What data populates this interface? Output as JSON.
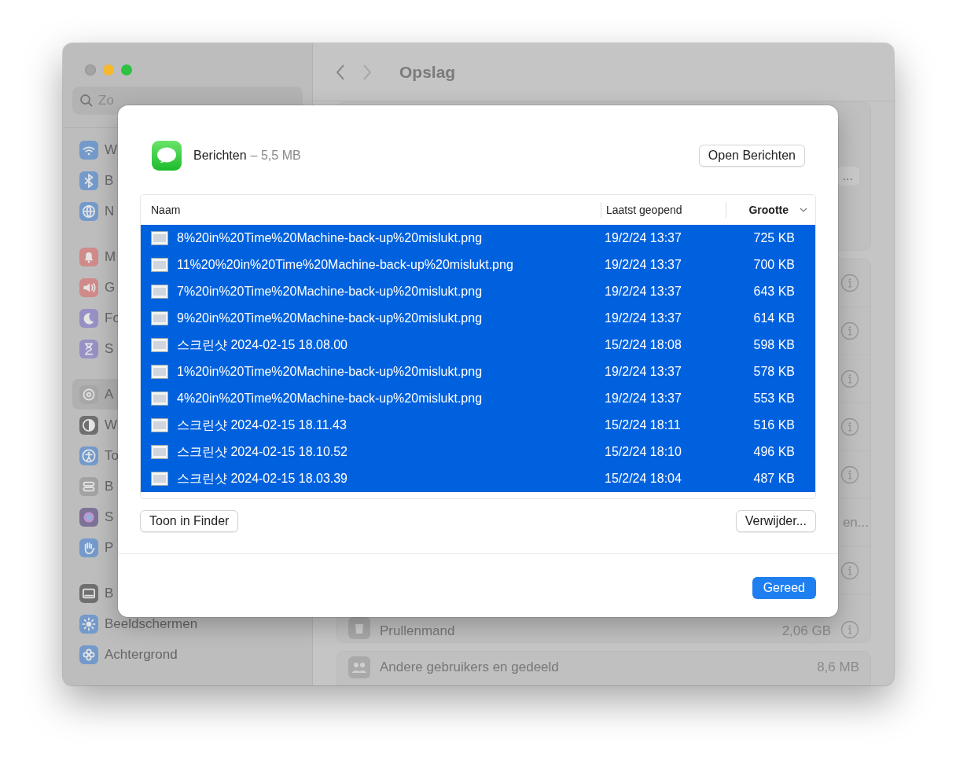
{
  "sidebar": {
    "search": {
      "placeholder": "Zo"
    },
    "groups": [
      {
        "items": [
          {
            "label": "W",
            "selected": false
          },
          {
            "label": "B",
            "selected": false
          },
          {
            "label": "N",
            "selected": false
          }
        ]
      },
      {
        "items": [
          {
            "label": "M",
            "selected": false
          },
          {
            "label": "G",
            "selected": false
          },
          {
            "label": "Fo",
            "selected": false
          },
          {
            "label": "S",
            "selected": false
          }
        ]
      },
      {
        "items": [
          {
            "label": "A",
            "selected": true
          },
          {
            "label": "W",
            "selected": false
          },
          {
            "label": "To",
            "selected": false
          },
          {
            "label": "B",
            "selected": false
          },
          {
            "label": "S",
            "selected": false
          },
          {
            "label": "P",
            "selected": false
          }
        ]
      },
      {
        "items": [
          {
            "label": "B",
            "selected": false
          },
          {
            "label": "Beeldschermen",
            "selected": false
          },
          {
            "label": "Achtergrond",
            "selected": false
          }
        ]
      }
    ]
  },
  "toolbar": {
    "title": "Opslag"
  },
  "content": {
    "top_card": {
      "button": "..."
    },
    "rows": [
      {
        "kind": "info"
      },
      {
        "kind": "info"
      },
      {
        "kind": "info"
      },
      {
        "kind": "info"
      },
      {
        "kind": "info"
      },
      {
        "kind": "text",
        "value": "en..."
      },
      {
        "kind": "info"
      },
      {
        "kind": "item",
        "label": "Prullenmand",
        "value": "2,06 GB"
      }
    ],
    "bottom_card": {
      "label": "Andere gebruikers en gedeeld",
      "value": "8,6 MB"
    }
  },
  "sheet": {
    "app_name": "Berichten",
    "app_size": "– 5,5 MB",
    "open_button": "Open Berichten",
    "table": {
      "columns": [
        {
          "label": "Naam",
          "sorted": false
        },
        {
          "label": "Laatst geopend",
          "sorted": false
        },
        {
          "label": "Grootte",
          "sorted": true
        }
      ],
      "rows": [
        {
          "name": "8%20in%20Time%20Machine-back-up%20mislukt.png",
          "opened": "19/2/24 13:37",
          "size": "725 KB",
          "selected": true
        },
        {
          "name": "11%20%20in%20Time%20Machine-back-up%20mislukt.png",
          "opened": "19/2/24 13:37",
          "size": "700 KB",
          "selected": true
        },
        {
          "name": "7%20in%20Time%20Machine-back-up%20mislukt.png",
          "opened": "19/2/24 13:37",
          "size": "643 KB",
          "selected": true
        },
        {
          "name": "9%20in%20Time%20Machine-back-up%20mislukt.png",
          "opened": "19/2/24 13:37",
          "size": "614 KB",
          "selected": true
        },
        {
          "name": "스크린샷 2024-02-15 18.08.00",
          "opened": "15/2/24 18:08",
          "size": "598 KB",
          "selected": true
        },
        {
          "name": "1%20in%20Time%20Machine-back-up%20mislukt.png",
          "opened": "19/2/24 13:37",
          "size": "578 KB",
          "selected": true
        },
        {
          "name": "4%20in%20Time%20Machine-back-up%20mislukt.png",
          "opened": "19/2/24 13:37",
          "size": "553 KB",
          "selected": true
        },
        {
          "name": "스크린샷 2024-02-15 18.11.43",
          "opened": "15/2/24 18:11",
          "size": "516 KB",
          "selected": true
        },
        {
          "name": "스크린샷 2024-02-15 18.10.52",
          "opened": "15/2/24 18:10",
          "size": "496 KB",
          "selected": true
        },
        {
          "name": "스크린샷 2024-02-15 18.03.39",
          "opened": "15/2/24 18:04",
          "size": "487 KB",
          "selected": true
        }
      ]
    },
    "show_button": "Toon in Finder",
    "delete_button": "Verwijder...",
    "done_button": "Gereed"
  }
}
